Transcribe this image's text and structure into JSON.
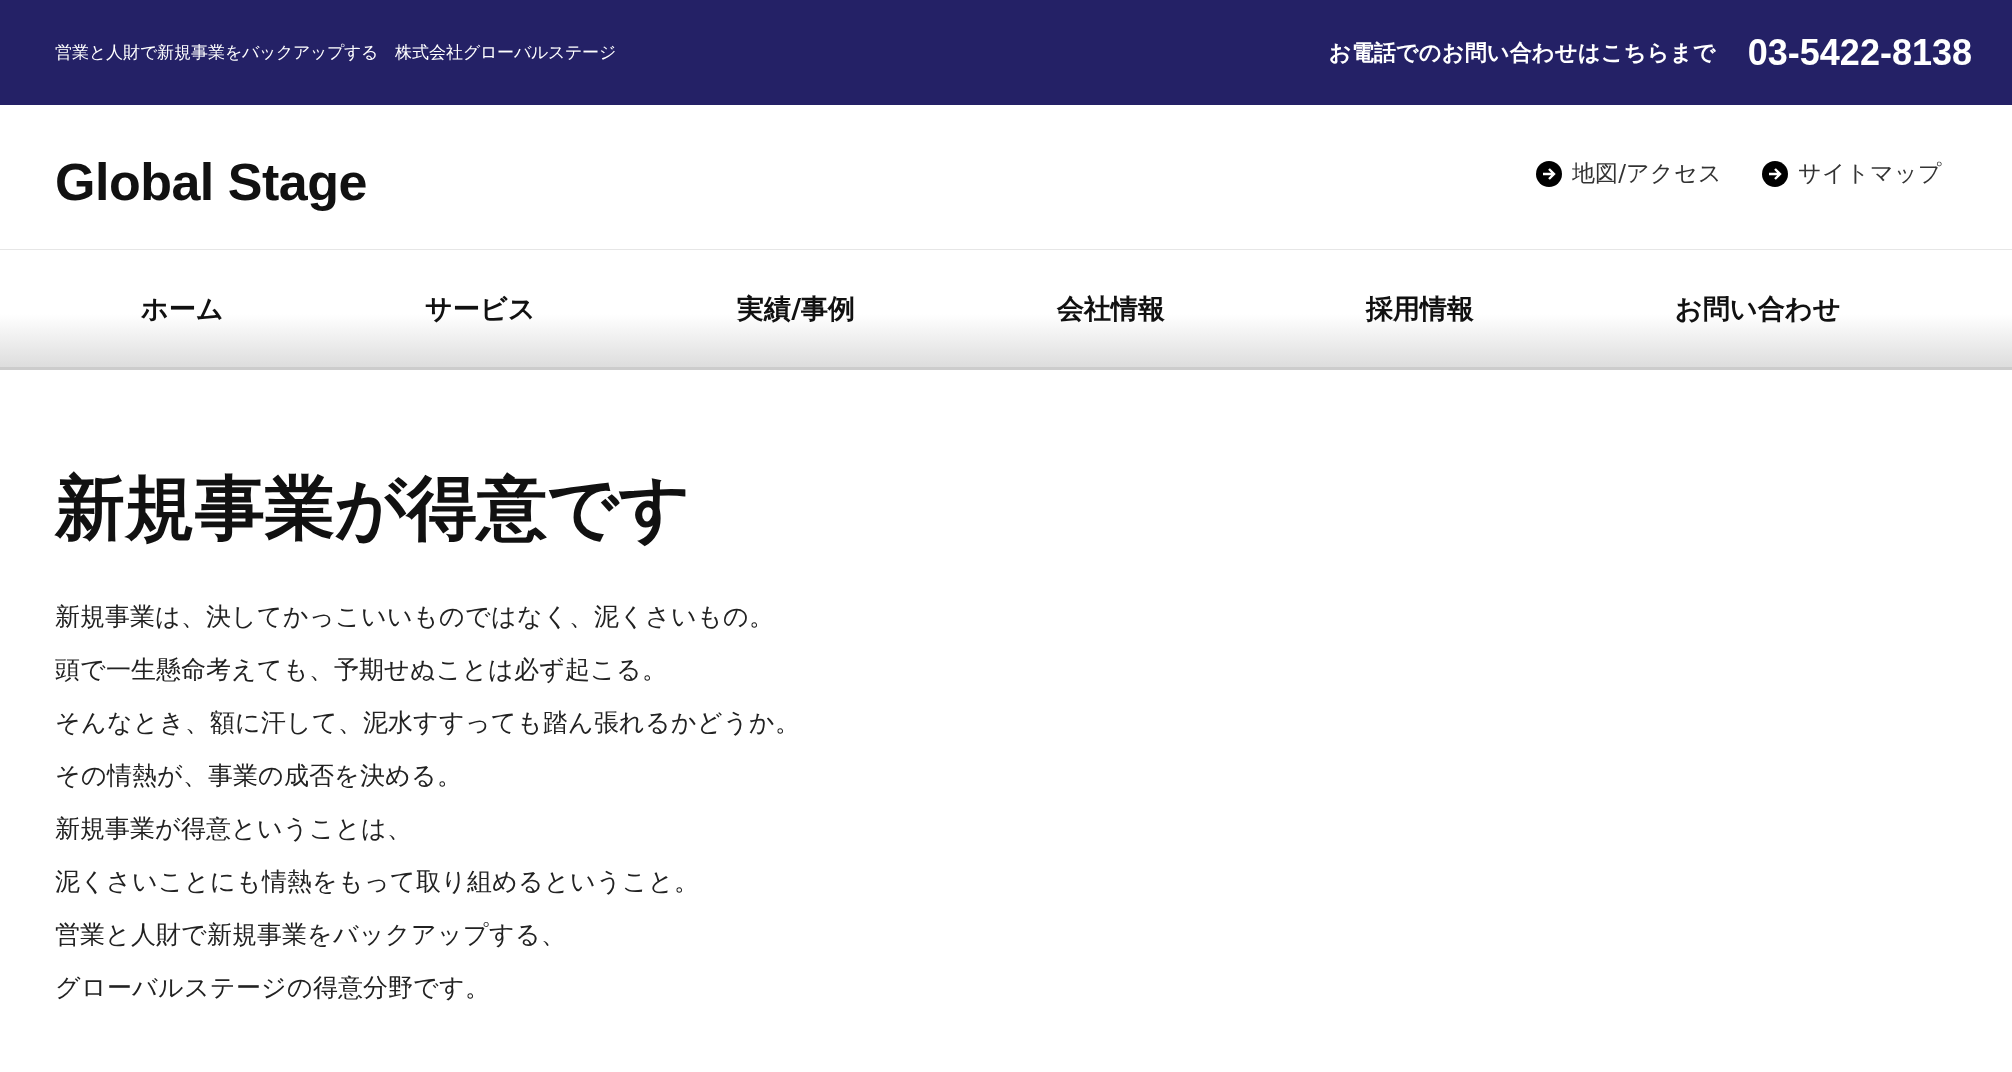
{
  "top_bar": {
    "tagline": "営業と人財で新規事業をバックアップする　株式会社グローバルステージ",
    "phone_label": "お電話でのお問い合わせはこちらまで",
    "phone_number": "03-5422-8138"
  },
  "header": {
    "logo": "Global Stage",
    "links": [
      "地図/アクセス",
      "サイトマップ"
    ]
  },
  "nav": [
    "ホーム",
    "サービス",
    "実績/事例",
    "会社情報",
    "採用情報",
    "お問い合わせ"
  ],
  "content": {
    "heading": "新規事業が得意です",
    "lines": [
      "新規事業は、決してかっこいいものではなく、泥くさいもの。",
      "頭で一生懸命考えても、予期せぬことは必ず起こる。",
      "そんなとき、額に汗して、泥水すすっても踏ん張れるかどうか。",
      "その情熱が、事業の成否を決める。",
      "新規事業が得意ということは、",
      "泥くさいことにも情熱をもって取り組めるということ。",
      "営業と人財で新規事業をバックアップする、",
      "グローバルステージの得意分野です。"
    ]
  }
}
